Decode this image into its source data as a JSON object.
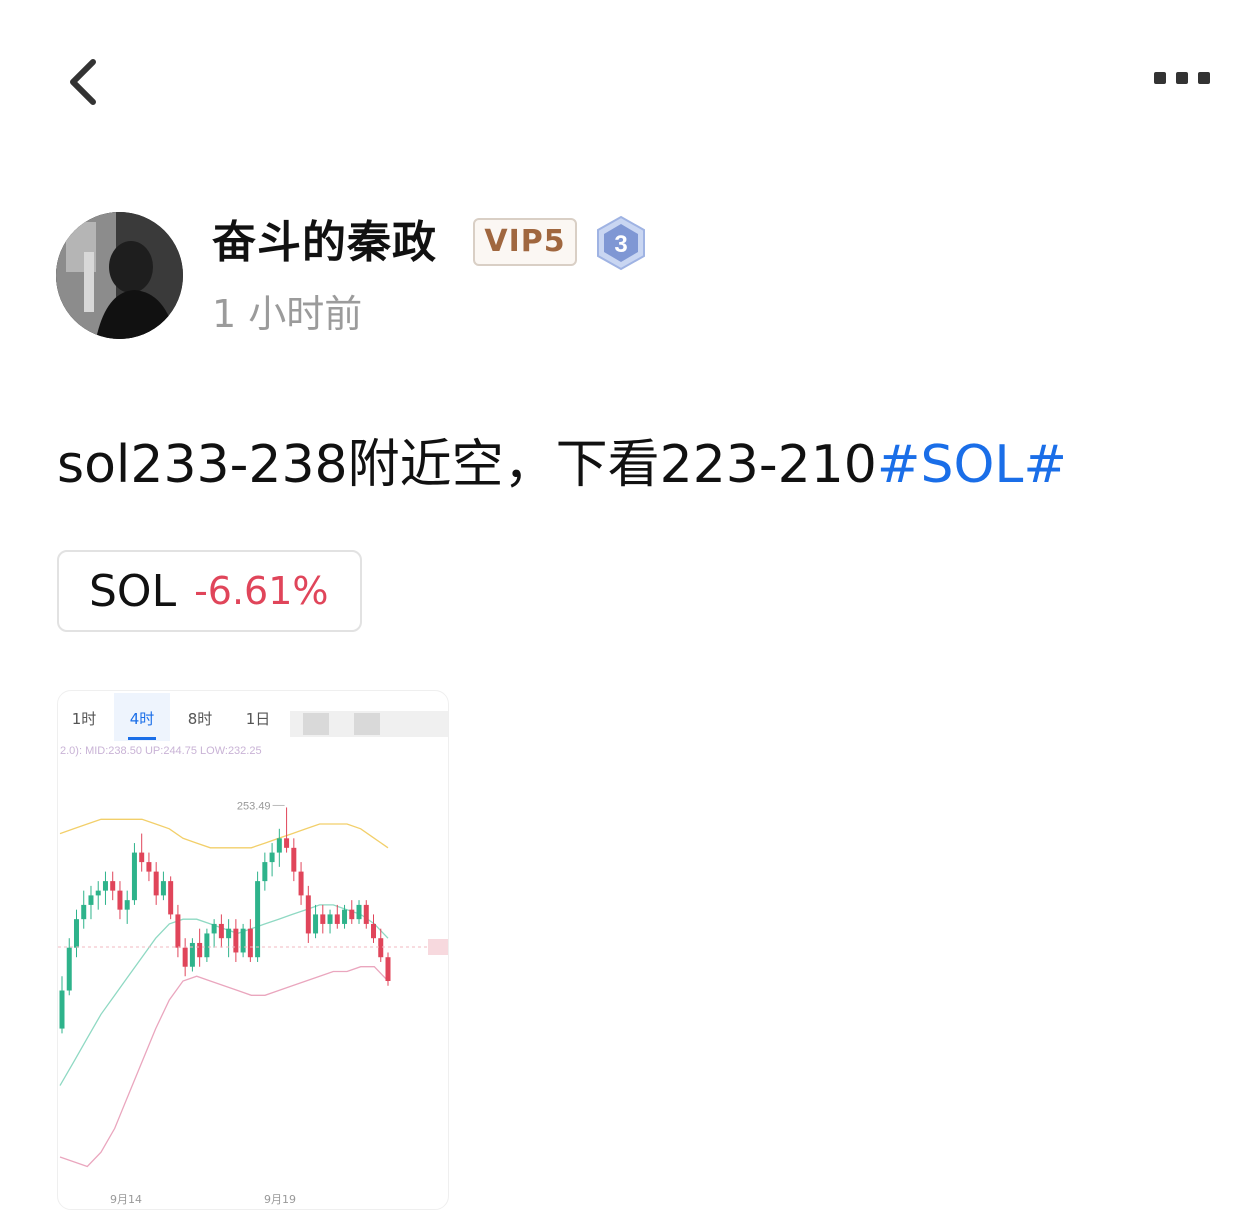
{
  "header": {
    "back_icon": "chevron-left-icon",
    "more_icon": "more-horizontal-icon"
  },
  "author": {
    "name": "奋斗的秦政",
    "vip": "VIP5",
    "level": "3",
    "time": "1 小时前"
  },
  "post": {
    "text": "sol233-238附近空，下看223-210",
    "hashtag": "#SOL#"
  },
  "coin": {
    "symbol": "SOL",
    "change": "-6.61%"
  },
  "colors": {
    "hashtag": "#1a6ee8",
    "negative": "#e0455a",
    "positive": "#2eb38b",
    "vip_text": "#a0673f"
  },
  "chart_data": {
    "type": "candlestick",
    "tabs": [
      "1时",
      "4时",
      "8时",
      "1日"
    ],
    "active_tab": "4时",
    "indicator_label": "2.0): MID:238.50 UP:244.75 LOW:232.25",
    "high_marker": "253.49",
    "x_labels": [
      "9月14",
      "9月19"
    ],
    "candles": [
      {
        "o": 207,
        "h": 218,
        "l": 206,
        "c": 215
      },
      {
        "o": 215,
        "h": 226,
        "l": 214,
        "c": 224
      },
      {
        "o": 224,
        "h": 232,
        "l": 222,
        "c": 230
      },
      {
        "o": 230,
        "h": 236,
        "l": 228,
        "c": 233
      },
      {
        "o": 233,
        "h": 237,
        "l": 230,
        "c": 235
      },
      {
        "o": 235,
        "h": 238,
        "l": 232,
        "c": 236
      },
      {
        "o": 236,
        "h": 240,
        "l": 233,
        "c": 238
      },
      {
        "o": 238,
        "h": 240,
        "l": 234,
        "c": 236
      },
      {
        "o": 236,
        "h": 238,
        "l": 230,
        "c": 232
      },
      {
        "o": 232,
        "h": 236,
        "l": 229,
        "c": 234
      },
      {
        "o": 234,
        "h": 246,
        "l": 233,
        "c": 244
      },
      {
        "o": 244,
        "h": 248,
        "l": 240,
        "c": 242
      },
      {
        "o": 242,
        "h": 244,
        "l": 238,
        "c": 240
      },
      {
        "o": 240,
        "h": 242,
        "l": 233,
        "c": 235
      },
      {
        "o": 235,
        "h": 240,
        "l": 234,
        "c": 238
      },
      {
        "o": 238,
        "h": 239,
        "l": 230,
        "c": 231
      },
      {
        "o": 231,
        "h": 233,
        "l": 222,
        "c": 224
      },
      {
        "o": 224,
        "h": 226,
        "l": 218,
        "c": 220
      },
      {
        "o": 220,
        "h": 226,
        "l": 219,
        "c": 225
      },
      {
        "o": 225,
        "h": 228,
        "l": 220,
        "c": 222
      },
      {
        "o": 222,
        "h": 228,
        "l": 221,
        "c": 227
      },
      {
        "o": 227,
        "h": 230,
        "l": 224,
        "c": 229
      },
      {
        "o": 229,
        "h": 231,
        "l": 224,
        "c": 226
      },
      {
        "o": 226,
        "h": 230,
        "l": 222,
        "c": 228
      },
      {
        "o": 228,
        "h": 230,
        "l": 221,
        "c": 223
      },
      {
        "o": 223,
        "h": 229,
        "l": 222,
        "c": 228
      },
      {
        "o": 228,
        "h": 230,
        "l": 221,
        "c": 222
      },
      {
        "o": 222,
        "h": 240,
        "l": 221,
        "c": 238
      },
      {
        "o": 238,
        "h": 244,
        "l": 236,
        "c": 242
      },
      {
        "o": 242,
        "h": 246,
        "l": 239,
        "c": 244
      },
      {
        "o": 244,
        "h": 249,
        "l": 241,
        "c": 247
      },
      {
        "o": 247,
        "h": 253.49,
        "l": 244,
        "c": 245
      },
      {
        "o": 245,
        "h": 247,
        "l": 238,
        "c": 240
      },
      {
        "o": 240,
        "h": 242,
        "l": 233,
        "c": 235
      },
      {
        "o": 235,
        "h": 237,
        "l": 225,
        "c": 227
      },
      {
        "o": 227,
        "h": 233,
        "l": 226,
        "c": 231
      },
      {
        "o": 231,
        "h": 233,
        "l": 227,
        "c": 229
      },
      {
        "o": 229,
        "h": 232,
        "l": 227,
        "c": 231
      },
      {
        "o": 231,
        "h": 233,
        "l": 228,
        "c": 229
      },
      {
        "o": 229,
        "h": 233,
        "l": 228,
        "c": 232
      },
      {
        "o": 232,
        "h": 234,
        "l": 229,
        "c": 230
      },
      {
        "o": 230,
        "h": 234,
        "l": 229,
        "c": 233
      },
      {
        "o": 233,
        "h": 234,
        "l": 228,
        "c": 229
      },
      {
        "o": 229,
        "h": 231,
        "l": 225,
        "c": 226
      },
      {
        "o": 226,
        "h": 228,
        "l": 221,
        "c": 222
      },
      {
        "o": 222,
        "h": 223,
        "l": 216,
        "c": 217
      }
    ],
    "bands": {
      "upper": [
        248,
        249,
        250,
        251,
        251,
        251,
        251,
        250,
        249,
        247,
        246,
        245,
        245,
        245,
        245,
        246,
        247,
        248,
        249,
        250,
        250,
        250,
        249,
        247,
        245
      ],
      "middle": [
        195,
        200,
        205,
        210,
        214,
        218,
        222,
        226,
        229,
        230,
        230,
        229,
        228,
        227,
        228,
        229,
        230,
        231,
        232,
        233,
        233,
        232,
        231,
        229,
        226
      ],
      "lower": [
        180,
        179,
        178,
        181,
        186,
        193,
        200,
        207,
        213,
        217,
        218,
        217,
        216,
        215,
        214,
        214,
        215,
        216,
        217,
        218,
        219,
        219,
        220,
        220,
        217
      ]
    },
    "ylim": [
      176,
      258
    ]
  }
}
